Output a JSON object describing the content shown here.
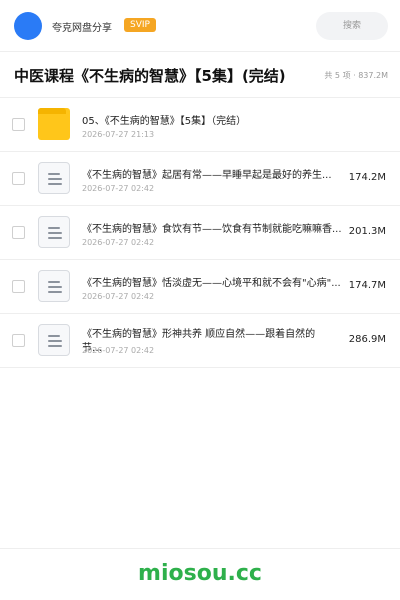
{
  "header": {
    "share_name": "夸克网盘分享",
    "badge": "SVIP",
    "search_label": "搜索"
  },
  "folder": {
    "title": "中医课程《不生病的智慧》【5集】(完结)",
    "count": "共 5 项 · 837.2M"
  },
  "items": [
    {
      "icon": "folder-icon",
      "name": "05、《不生病的智慧》【5集】（完结）",
      "date": "2026-07-27 21:13",
      "size": ""
    },
    {
      "icon": "document-icon",
      "name": "《不生病的智慧》起居有常——早睡早起是最好的养生...",
      "date": "2026-07-27 02:42",
      "size": "174.2M"
    },
    {
      "icon": "document-icon",
      "name": "《不生病的智慧》食饮有节——饮食有节制就能吃嘛嘛香...",
      "date": "2026-07-27 02:42",
      "size": "201.3M"
    },
    {
      "icon": "document-icon",
      "name": "《不生病的智慧》恬淡虚无——心境平和就不会有\"心病\"...",
      "date": "2026-07-27 02:42",
      "size": "174.7M"
    },
    {
      "icon": "document-icon",
      "name": "《不生病的智慧》形神共养 顺应自然——跟着自然的节…",
      "date": "2026-07-27 02:42",
      "size": "286.9M"
    }
  ],
  "footer": {
    "logo_text": "miosou.cc"
  },
  "colors": {
    "brand_blue": "#2a7bf6",
    "svip_orange": "#f5a623",
    "folder_yellow": "#ffc61a",
    "logo_green": "#2eb04b"
  }
}
